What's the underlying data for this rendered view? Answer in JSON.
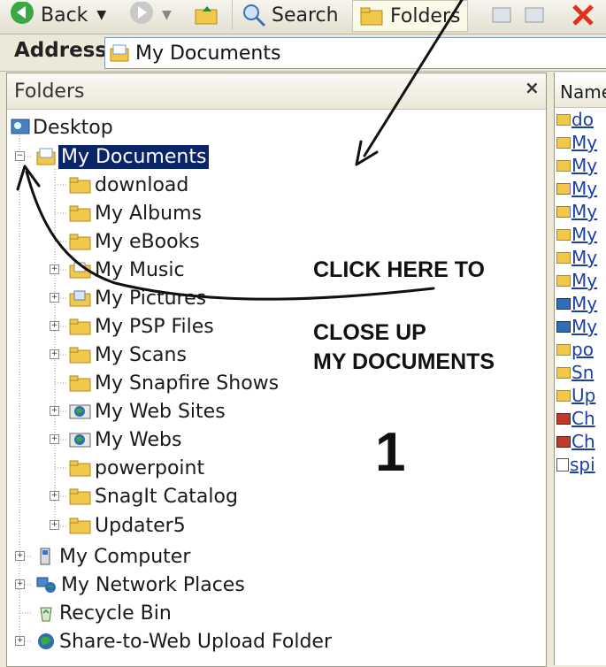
{
  "toolbar": {
    "back_label": "Back",
    "search_label": "Search",
    "folders_label": "Folders"
  },
  "address": {
    "label": "Address",
    "value": "My Documents"
  },
  "folders_pane": {
    "title": "Folders",
    "close_glyph": "×",
    "tree": {
      "desktop": "Desktop",
      "my_documents": "My Documents",
      "download": "download",
      "my_albums": "My Albums",
      "my_ebooks": "My eBooks",
      "my_music": "My Music",
      "my_pictures": "My Pictures",
      "my_psp_files": "My PSP Files",
      "my_scans": "My Scans",
      "my_snapfire_shows": "My Snapfire Shows",
      "my_web_sites": "My Web Sites",
      "my_webs": "My Webs",
      "powerpoint": "powerpoint",
      "snagit_catalog": "SnagIt Catalog",
      "updater5": "Updater5",
      "my_computer": "My Computer",
      "my_network_places": "My Network Places",
      "recycle_bin": "Recycle Bin",
      "share_to_web": "Share-to-Web Upload Folder"
    }
  },
  "name_pane": {
    "header": "Name",
    "rows": [
      "do",
      "My",
      "My",
      "My",
      "My",
      "My",
      "My",
      "My",
      "My",
      "My",
      "po",
      "Sn",
      "Up",
      "Ch",
      "Ch",
      "spi"
    ]
  },
  "annotations": {
    "line1": "CLICK HERE TO",
    "line2": "CLOSE UP",
    "line3": "MY DOCUMENTS",
    "step_number": "1"
  },
  "colors": {
    "selection": "#0a246a",
    "folder_yellow": "#f2c84b",
    "link_blue": "#1a3fa6"
  }
}
